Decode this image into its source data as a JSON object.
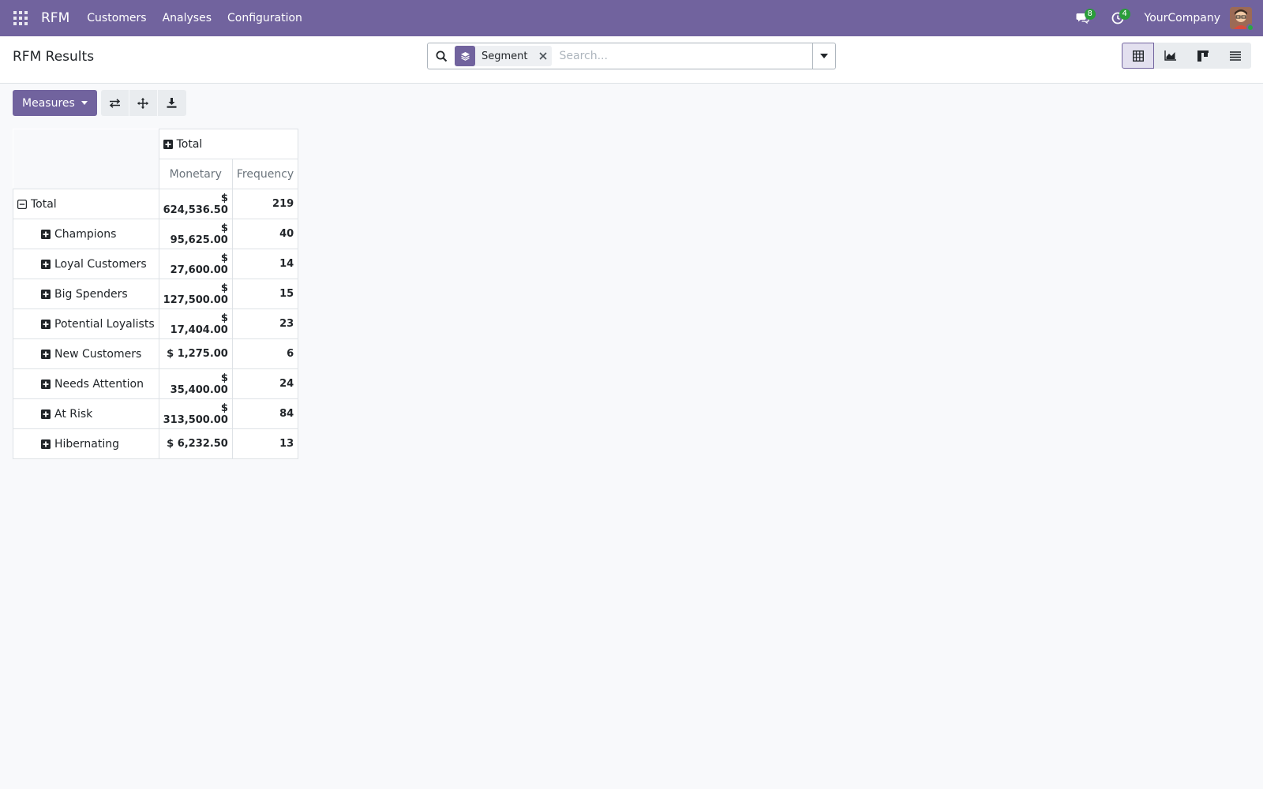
{
  "navbar": {
    "brand": "RFM",
    "menus": [
      "Customers",
      "Analyses",
      "Configuration"
    ],
    "messages_count": "8",
    "activities_count": "4",
    "company": "YourCompany",
    "bg_color": "#71639e"
  },
  "control": {
    "title": "RFM Results",
    "facet_label": "Segment",
    "search_placeholder": "Search..."
  },
  "toolbar": {
    "measures_label": "Measures"
  },
  "pivot": {
    "column_header": "Total",
    "measures": [
      "Monetary",
      "Frequency"
    ],
    "total_row": {
      "label": "Total",
      "monetary": "$ 624,536.50",
      "frequency": "219"
    },
    "rows": [
      {
        "label": "Champions",
        "monetary": "$ 95,625.00",
        "frequency": "40"
      },
      {
        "label": "Loyal Customers",
        "monetary": "$ 27,600.00",
        "frequency": "14"
      },
      {
        "label": "Big Spenders",
        "monetary": "$ 127,500.00",
        "frequency": "15"
      },
      {
        "label": "Potential Loyalists",
        "monetary": "$ 17,404.00",
        "frequency": "23"
      },
      {
        "label": "New Customers",
        "monetary": "$ 1,275.00",
        "frequency": "6"
      },
      {
        "label": "Needs Attention",
        "monetary": "$ 35,400.00",
        "frequency": "24"
      },
      {
        "label": "At Risk",
        "monetary": "$ 313,500.00",
        "frequency": "84"
      },
      {
        "label": "Hibernating",
        "monetary": "$ 6,232.50",
        "frequency": "13"
      }
    ]
  },
  "icons": {
    "apps": "apps-grid-icon",
    "messages": "chat-icon",
    "activities": "clock-icon",
    "search": "search-icon",
    "facet": "layers-icon",
    "views": [
      "pivot-table-icon",
      "graph-icon",
      "kanban-icon",
      "list-icon"
    ],
    "tools": [
      "flip-axis-icon",
      "expand-all-icon",
      "download-icon"
    ]
  }
}
